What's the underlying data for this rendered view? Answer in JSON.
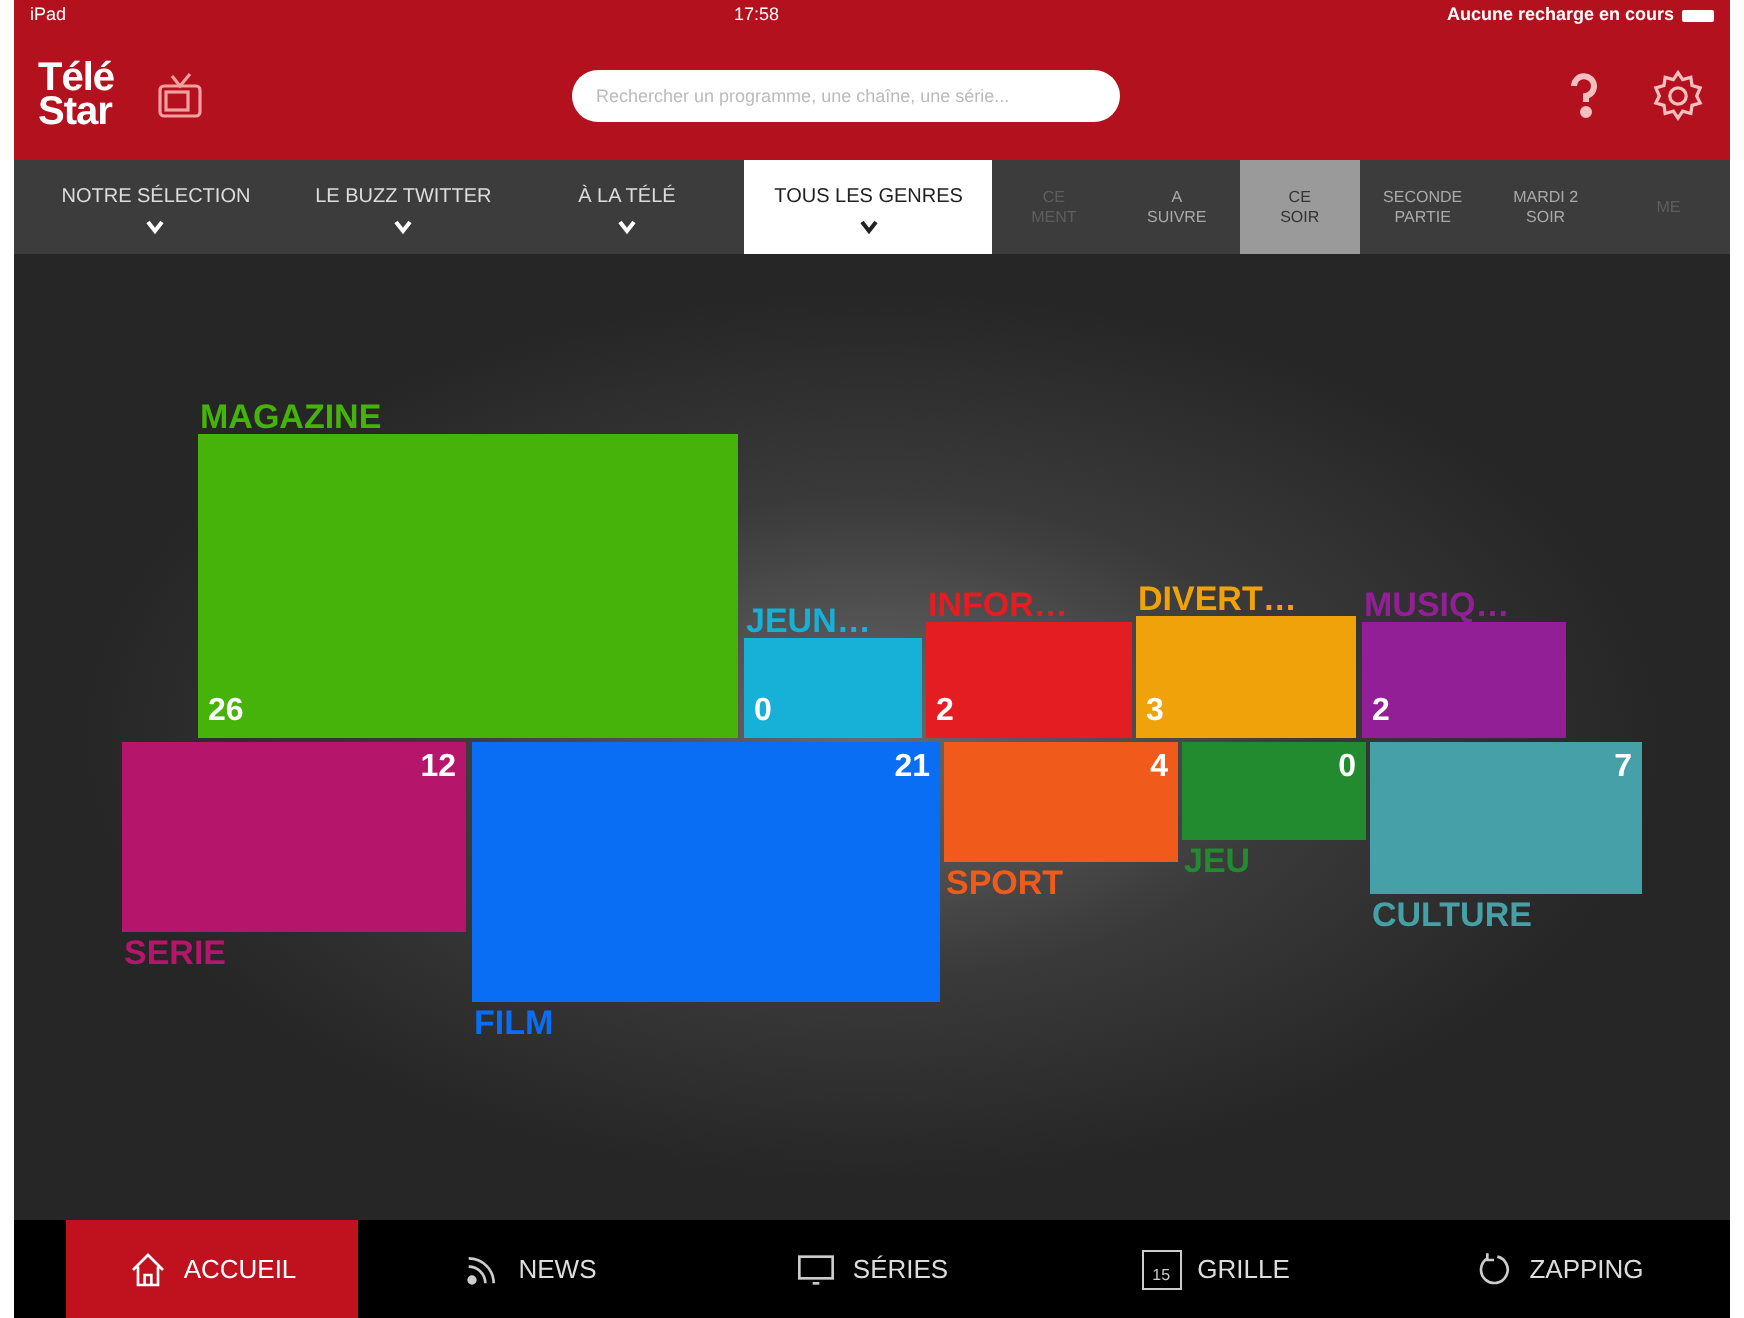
{
  "status_bar": {
    "device": "iPad",
    "time": "17:58",
    "battery_text": "Aucune recharge en cours"
  },
  "header": {
    "logo_line_1": "Télé",
    "logo_line_2": "Star",
    "search": {
      "placeholder": "Rechercher un programme, une chaîne, une série..."
    }
  },
  "filters": [
    {
      "label": "NOTRE SÉLECTION",
      "selected": false
    },
    {
      "label": "LE BUZZ TWITTER",
      "selected": false
    },
    {
      "label": "À LA TÉLÉ",
      "selected": false
    },
    {
      "label": "TOUS LES GENRES",
      "selected": true
    }
  ],
  "time_tabs": [
    {
      "lines": [
        "CE",
        "MENT"
      ],
      "selected": false,
      "disabled": true
    },
    {
      "lines": [
        "A",
        "SUIVRE"
      ],
      "selected": false,
      "disabled": false
    },
    {
      "lines": [
        "CE",
        "SOIR"
      ],
      "selected": true,
      "disabled": false
    },
    {
      "lines": [
        "SECONDE",
        "PARTIE"
      ],
      "selected": false,
      "disabled": false
    },
    {
      "lines": [
        "MARDI 2",
        "SOIR"
      ],
      "selected": false,
      "disabled": false
    },
    {
      "lines": [
        "ME"
      ],
      "selected": false,
      "disabled": true
    }
  ],
  "genres": [
    {
      "name": "MAGAZINE",
      "count": "26",
      "color": "#46b30a",
      "kind": "top"
    },
    {
      "name": "JEUN…",
      "count": "0",
      "color": "#17b0d6",
      "kind": "top"
    },
    {
      "name": "INFOR…",
      "count": "2",
      "color": "#e31d22",
      "kind": "top"
    },
    {
      "name": "DIVERT…",
      "count": "3",
      "color": "#f0a20a",
      "kind": "top"
    },
    {
      "name": "MUSIQ…",
      "count": "2",
      "color": "#931f97",
      "kind": "top"
    },
    {
      "name": "SERIE",
      "count": "12",
      "color": "#b5166b",
      "kind": "bottom"
    },
    {
      "name": "FILM",
      "count": "21",
      "color": "#0a6ef5",
      "kind": "bottom"
    },
    {
      "name": "SPORT",
      "count": "4",
      "color": "#f05a1a",
      "kind": "bottom"
    },
    {
      "name": "JEU",
      "count": "0",
      "color": "#228b30",
      "kind": "bottom"
    },
    {
      "name": "CULTURE",
      "count": "7",
      "color": "#45a0a8",
      "kind": "bottom"
    }
  ],
  "nav": [
    {
      "label": "ACCUEIL",
      "selected": true,
      "kind": "home"
    },
    {
      "label": "NEWS",
      "selected": false,
      "kind": "feed"
    },
    {
      "label": "SÉRIES",
      "selected": false,
      "kind": "tv"
    },
    {
      "label": "GRILLE",
      "selected": false,
      "kind": "calendar",
      "icon_text": "15"
    },
    {
      "label": "ZAPPING",
      "selected": false,
      "kind": "refresh"
    }
  ]
}
